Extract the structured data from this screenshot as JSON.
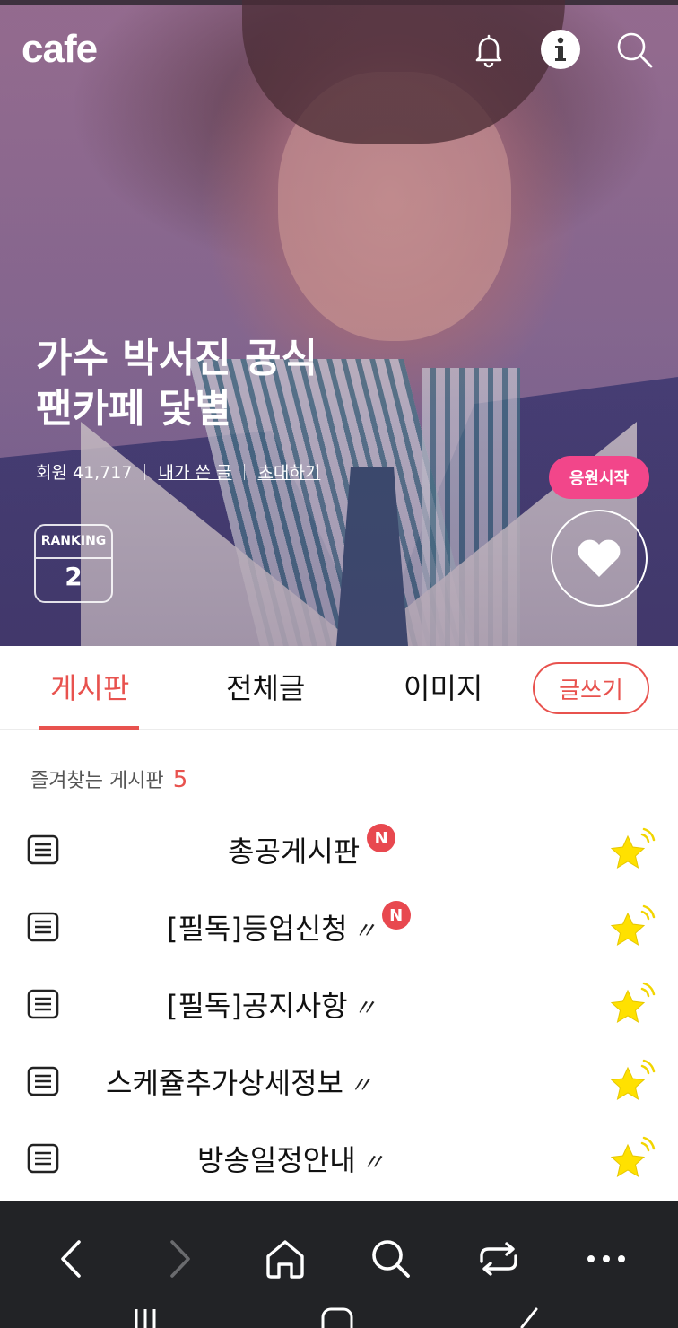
{
  "app": {
    "logo": "cafe"
  },
  "hero": {
    "title_line1": "가수 박서진 공식",
    "title_line2": "팬카페 닻별",
    "members_label": "회원 41,717",
    "my_posts": "내가 쓴 글",
    "invite": "초대하기",
    "cheer_button": "응원시작",
    "ranking_label": "RANKING",
    "ranking_value": "2"
  },
  "tabs": [
    {
      "label": "게시판",
      "active": true
    },
    {
      "label": "전체글",
      "active": false
    },
    {
      "label": "이미지",
      "active": false
    }
  ],
  "write_button": "글쓰기",
  "favorites": {
    "title": "즐겨찾는 게시판",
    "count": "5",
    "items": [
      {
        "name": "총공게시판",
        "new_badge": "N",
        "mark": ""
      },
      {
        "name": "[필독]등업신청",
        "new_badge": "N",
        "mark": "〃"
      },
      {
        "name": "[필독]공지사항",
        "new_badge": "",
        "mark": "〃"
      },
      {
        "name": "스케쥴추가상세정보",
        "new_badge": "",
        "mark": "〃"
      },
      {
        "name": "방송일정안내",
        "new_badge": "",
        "mark": "〃"
      }
    ]
  },
  "colors": {
    "accent": "#e8524e",
    "cheer": "#f2468a",
    "star": "#ffe100",
    "nav_bg": "#222326"
  },
  "icons": {
    "header": [
      "bell-icon",
      "info-icon",
      "search-icon"
    ],
    "bottom_nav": [
      "back-icon",
      "forward-icon",
      "home-icon",
      "search-icon",
      "tabs-icon",
      "more-icon"
    ]
  }
}
